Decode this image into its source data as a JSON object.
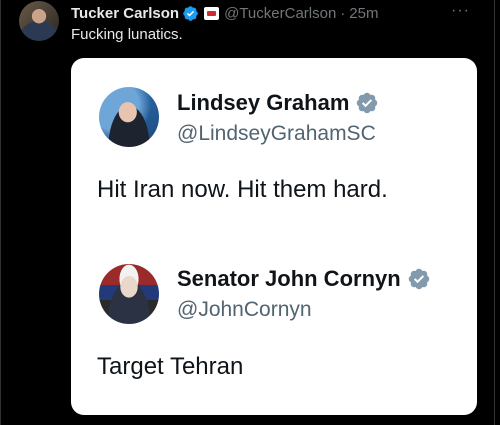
{
  "post": {
    "author_name": "Tucker Carlson",
    "author_handle": "@TuckerCarlson",
    "separator": "·",
    "time": "25m",
    "text": "Fucking lunatics.",
    "more_glyph": "···"
  },
  "quoted": [
    {
      "name": "Lindsey Graham",
      "handle": "@LindseyGrahamSC",
      "text": "Hit Iran now. Hit them hard."
    },
    {
      "name": "Senator John Cornyn",
      "handle": "@JohnCornyn",
      "text": "Target Tehran"
    }
  ],
  "colors": {
    "background": "#000000",
    "verified_blue": "#1d9bf0",
    "verified_gray": "#829aab",
    "muted_text": "#71767b"
  },
  "icons": [
    "verified-badge-icon",
    "affiliation-badge-icon",
    "more-options-icon",
    "gray-verified-badge-icon"
  ]
}
